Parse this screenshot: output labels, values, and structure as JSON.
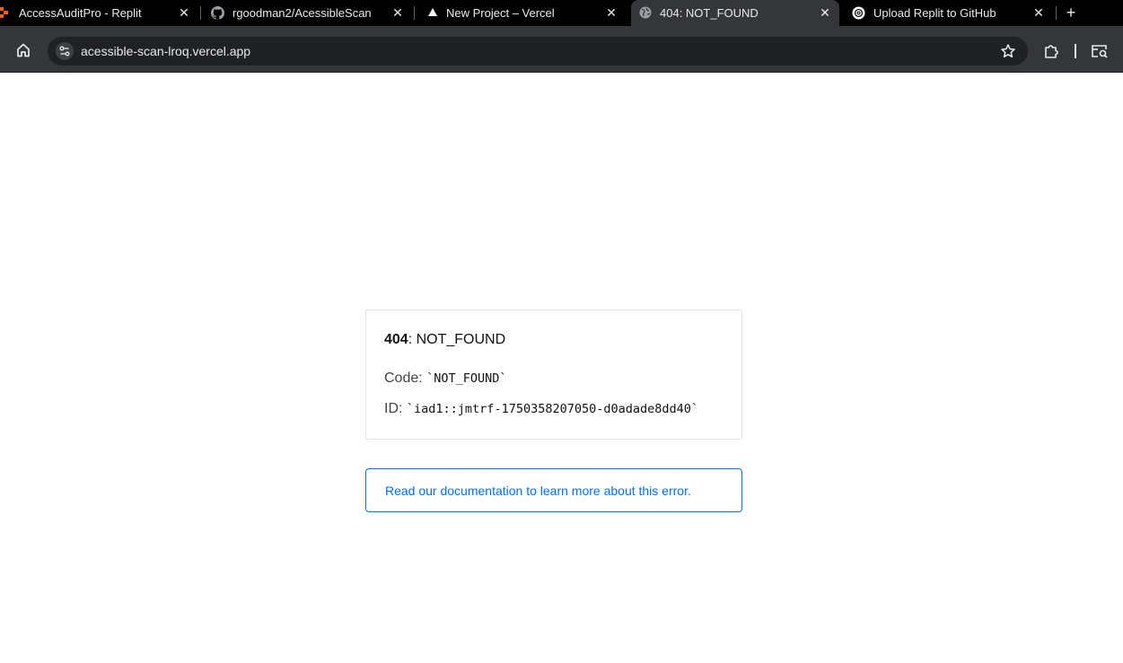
{
  "browser": {
    "tabs": [
      {
        "title": "AccessAuditPro - Replit",
        "favicon": "replit-icon",
        "active": false
      },
      {
        "title": "rgoodman2/AcessibleScan",
        "favicon": "github-icon",
        "active": false
      },
      {
        "title": "New Project – Vercel",
        "favicon": "vercel-icon",
        "active": false
      },
      {
        "title": "404: NOT_FOUND",
        "favicon": "globe-icon",
        "active": true
      },
      {
        "title": "Upload Replit to GitHub",
        "favicon": "openai-icon",
        "active": false
      }
    ],
    "close_glyph": "✕",
    "new_tab_glyph": "+",
    "address": "acessible-scan-lroq.vercel.app"
  },
  "error": {
    "status_code": "404",
    "status_text": ": NOT_FOUND",
    "code_label": "Code:",
    "code_value": "`NOT_FOUND`",
    "id_label": "ID:",
    "id_value": "`iad1::jmtrf-1750358207050-d0adade8dd40`"
  },
  "docs_link": {
    "label": "Read our documentation to learn more about this error."
  },
  "colors": {
    "tabstrip": "#000000",
    "toolbar": "#35363a",
    "omnibox": "#202124",
    "link": "#0070f3",
    "card_border": "#e5e5e5"
  }
}
